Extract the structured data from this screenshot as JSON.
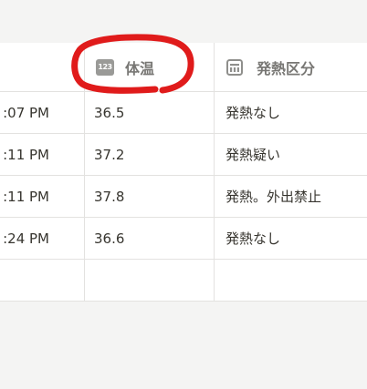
{
  "table": {
    "columns": [
      {
        "label": "",
        "icon": ""
      },
      {
        "label": "体温",
        "icon": "number-icon",
        "icon_text": "123"
      },
      {
        "label": "発熱区分",
        "icon": "select-icon"
      }
    ],
    "rows": [
      {
        "time": ":07 PM",
        "temp": "36.5",
        "category": "発熱なし"
      },
      {
        "time": ":11 PM",
        "temp": "37.2",
        "category": "発熱疑い"
      },
      {
        "time": ":11 PM",
        "temp": "37.8",
        "category": "発熱。外出禁止"
      },
      {
        "time": ":24 PM",
        "temp": "36.6",
        "category": "発熱なし"
      }
    ]
  },
  "annotation": {
    "color": "#e01b1b"
  }
}
